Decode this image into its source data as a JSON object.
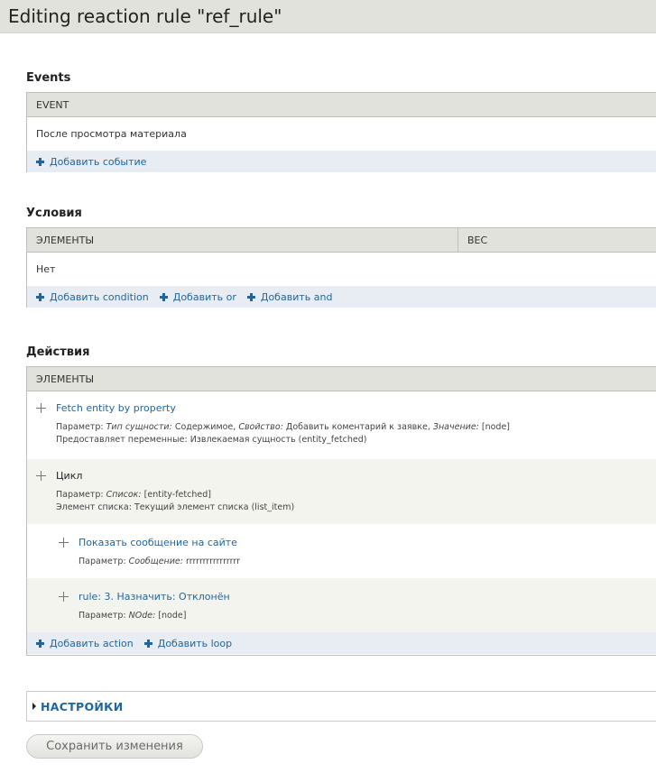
{
  "page": {
    "title": "Editing reaction rule \"ref_rule\""
  },
  "events": {
    "heading": "Events",
    "column": "EVENT",
    "rows": [
      "После просмотра материала"
    ],
    "add_links": [
      "Добавить событие"
    ]
  },
  "conditions": {
    "heading": "Условия",
    "columns": [
      "ЭЛЕМЕНТЫ",
      "ВЕС"
    ],
    "rows": [
      "Нет"
    ],
    "add_links": [
      "Добавить condition",
      "Добавить or",
      "Добавить and"
    ]
  },
  "actions": {
    "heading": "Действия",
    "column": "ЭЛЕМЕНТЫ",
    "items": [
      {
        "title": "Fetch entity by property",
        "line1": {
          "prefix": "Параметр: ",
          "k1": "Тип сущности:",
          "v1": " Содержимое, ",
          "k2": "Свойство:",
          "v2": " Добавить коментарий к заявке, ",
          "k3": "Значение:",
          "v3": " [node]"
        },
        "line2": "Предоставляет переменные: Извлекаемая сущность (entity_fetched)"
      },
      {
        "title": "Цикл",
        "line1": {
          "prefix": "Параметр: ",
          "k1": "Список:",
          "v1": " [entity-fetched]"
        },
        "line2": "Элемент списка: Текущий элемент списка (list_item)"
      },
      {
        "title": "Показать сообщение на сайте",
        "line1": {
          "prefix": "Параметр: ",
          "k1": "Сообщение:",
          "v1": " rrrrrrrrrrrrrrrr"
        }
      },
      {
        "title": "rule: 3. Назначить: Отклонён",
        "line1": {
          "prefix": "Параметр: ",
          "k1": "NOde:",
          "v1": " [node]"
        }
      }
    ],
    "add_links": [
      "Добавить action",
      "Добавить loop"
    ]
  },
  "settings": {
    "label": "НАСТРОЙКИ"
  },
  "save_button": {
    "label": "Сохранить изменения"
  }
}
